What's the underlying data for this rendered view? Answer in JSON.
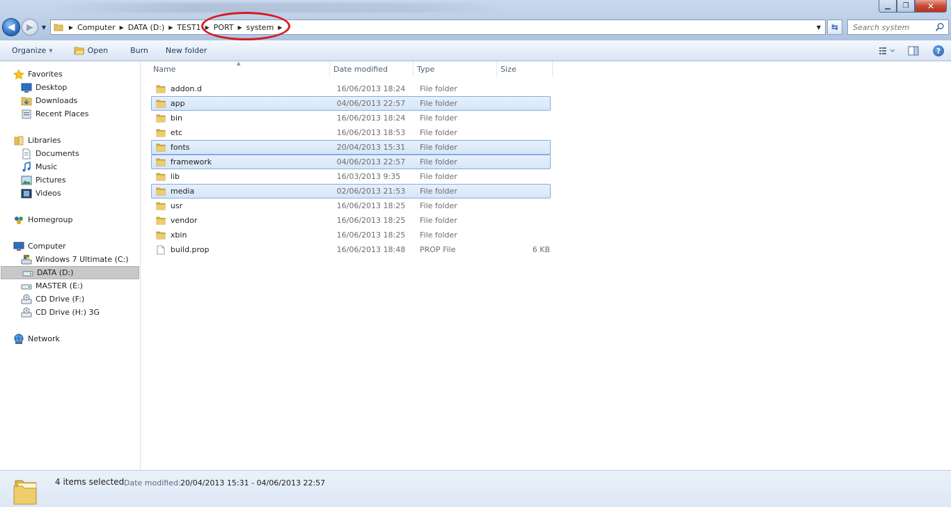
{
  "window": {
    "controls": {
      "minimize": "▁",
      "maximize": "❐",
      "close": "✕"
    }
  },
  "addressbar": {
    "crumbs": [
      "Computer",
      "DATA (D:)",
      "TEST1",
      "PORT",
      "system"
    ],
    "search_placeholder": "Search system"
  },
  "toolbar": {
    "organize": "Organize",
    "open": "Open",
    "burn": "Burn",
    "new_folder": "New folder"
  },
  "navigation": {
    "favorites": {
      "label": "Favorites",
      "items": [
        "Desktop",
        "Downloads",
        "Recent Places"
      ]
    },
    "libraries": {
      "label": "Libraries",
      "items": [
        "Documents",
        "Music",
        "Pictures",
        "Videos"
      ]
    },
    "homegroup": "Homegroup",
    "computer": {
      "label": "Computer",
      "items": [
        "Windows 7 Ultimate (C:)",
        "DATA (D:)",
        "MASTER (E:)",
        "CD Drive (F:)",
        "CD Drive (H:) 3G"
      ],
      "selected": "DATA (D:)"
    },
    "network": "Network"
  },
  "filelist": {
    "columns": [
      "Name",
      "Date modified",
      "Type",
      "Size"
    ],
    "sorted_by": "Name",
    "rows": [
      {
        "name": "addon.d",
        "date": "16/06/2013 18:24",
        "type": "File folder",
        "size": "",
        "selected": false,
        "kind": "folder"
      },
      {
        "name": "app",
        "date": "04/06/2013 22:57",
        "type": "File folder",
        "size": "",
        "selected": true,
        "kind": "folder"
      },
      {
        "name": "bin",
        "date": "16/06/2013 18:24",
        "type": "File folder",
        "size": "",
        "selected": false,
        "kind": "folder"
      },
      {
        "name": "etc",
        "date": "16/06/2013 18:53",
        "type": "File folder",
        "size": "",
        "selected": false,
        "kind": "folder"
      },
      {
        "name": "fonts",
        "date": "20/04/2013 15:31",
        "type": "File folder",
        "size": "",
        "selected": true,
        "kind": "folder"
      },
      {
        "name": "framework",
        "date": "04/06/2013 22:57",
        "type": "File folder",
        "size": "",
        "selected": true,
        "kind": "folder"
      },
      {
        "name": "lib",
        "date": "16/03/2013 9:35",
        "type": "File folder",
        "size": "",
        "selected": false,
        "kind": "folder"
      },
      {
        "name": "media",
        "date": "02/06/2013 21:53",
        "type": "File folder",
        "size": "",
        "selected": true,
        "kind": "folder"
      },
      {
        "name": "usr",
        "date": "16/06/2013 18:25",
        "type": "File folder",
        "size": "",
        "selected": false,
        "kind": "folder"
      },
      {
        "name": "vendor",
        "date": "16/06/2013 18:25",
        "type": "File folder",
        "size": "",
        "selected": false,
        "kind": "folder"
      },
      {
        "name": "xbin",
        "date": "16/06/2013 18:25",
        "type": "File folder",
        "size": "",
        "selected": false,
        "kind": "folder"
      },
      {
        "name": "build.prop",
        "date": "16/06/2013 18:48",
        "type": "PROP File",
        "size": "6 KB",
        "selected": false,
        "kind": "file"
      }
    ]
  },
  "details": {
    "count": "4 items selected",
    "date_label": "Date modified:",
    "date_range": "20/04/2013 15:31 - 04/06/2013 22:57"
  },
  "icons": {
    "back": "back-arrow-icon",
    "forward": "forward-arrow-icon",
    "refresh": "refresh-icon",
    "search": "search-icon",
    "help": "help-icon",
    "folder": "folder-icon",
    "file": "file-icon"
  },
  "colors": {
    "selection_bg": "#d6e6f8",
    "selection_border": "#84acdd",
    "annotation_oval": "#d61a1f",
    "nav_selected": "#c8c8c8"
  }
}
